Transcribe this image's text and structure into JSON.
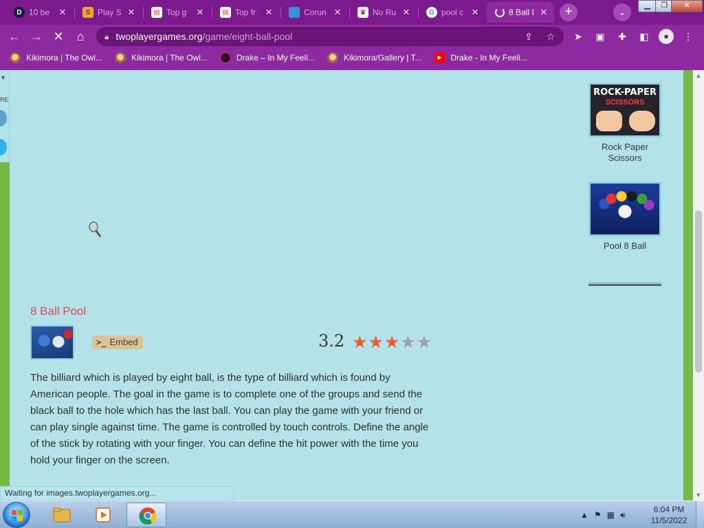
{
  "browser": {
    "tabs": [
      {
        "title": "10 be",
        "favicon": "d-logo-icon",
        "active": false
      },
      {
        "title": "Play S",
        "favicon": "s-logo-icon",
        "active": false
      },
      {
        "title": "Top g",
        "favicon": "store-icon",
        "active": false
      },
      {
        "title": "Top fr",
        "favicon": "store-icon",
        "active": false
      },
      {
        "title": "Corun",
        "favicon": "blue-square-icon",
        "active": false
      },
      {
        "title": "No Ru",
        "favicon": "crown-icon",
        "active": false
      },
      {
        "title": "pool c",
        "favicon": "google-icon",
        "active": false
      },
      {
        "title": "8 Ball I",
        "favicon": "loading-icon",
        "active": true
      }
    ],
    "url_host": "twoplayergames.org",
    "url_path": "/game/eight-ball-pool",
    "bookmarks": [
      {
        "label": "Kikimora | The Owl...",
        "icon": "owl"
      },
      {
        "label": "Kikimora | The Owl...",
        "icon": "owl"
      },
      {
        "label": "Drake – In My Feeli...",
        "icon": "drake"
      },
      {
        "label": "Kikimora/Gallery | T...",
        "icon": "owl"
      },
      {
        "label": "Drake - In My Feeli...",
        "icon": "yt"
      }
    ],
    "status_text": "Waiting for images.twoplayergames.org...",
    "colors": {
      "frame": "#8d2aa0",
      "tab_strip": "#7a1a8c",
      "omnibox": "#6a1479"
    }
  },
  "page": {
    "left_peek_text": "RE",
    "game_title": "8 Ball Pool",
    "embed_label": "Embed",
    "embed_icon": ">_",
    "rating": "3.2",
    "rating_stars": {
      "filled": 3,
      "total": 5
    },
    "description": "The billiard which is played by eight ball, is the type of billiard which is found by American people. The goal in the game is to complete one of the groups and send the black ball to the hole which has the last ball. You can play the game with your friend or can play single against time. The game is controlled by touch controls. Define the angle of the stick by rotating with your finger. You can define the hit power with the time you hold your finger on the screen.",
    "sidebar_games": [
      {
        "label": "Rock Paper Scissors",
        "thumb_top": "ROCK-PAPER",
        "thumb_mid": "SCISSORS"
      },
      {
        "label": "Pool 8 Ball"
      }
    ],
    "colors": {
      "background": "#b3e2e8",
      "title": "#e34a4a",
      "star_on": "#ee5a2b",
      "star_off": "#9aa3a8",
      "side_border": "#77b947"
    }
  },
  "taskbar": {
    "apps": [
      "explorer",
      "media-player",
      "chrome"
    ],
    "active_app": "chrome",
    "time": "6:04 PM",
    "date": "11/5/2022"
  }
}
